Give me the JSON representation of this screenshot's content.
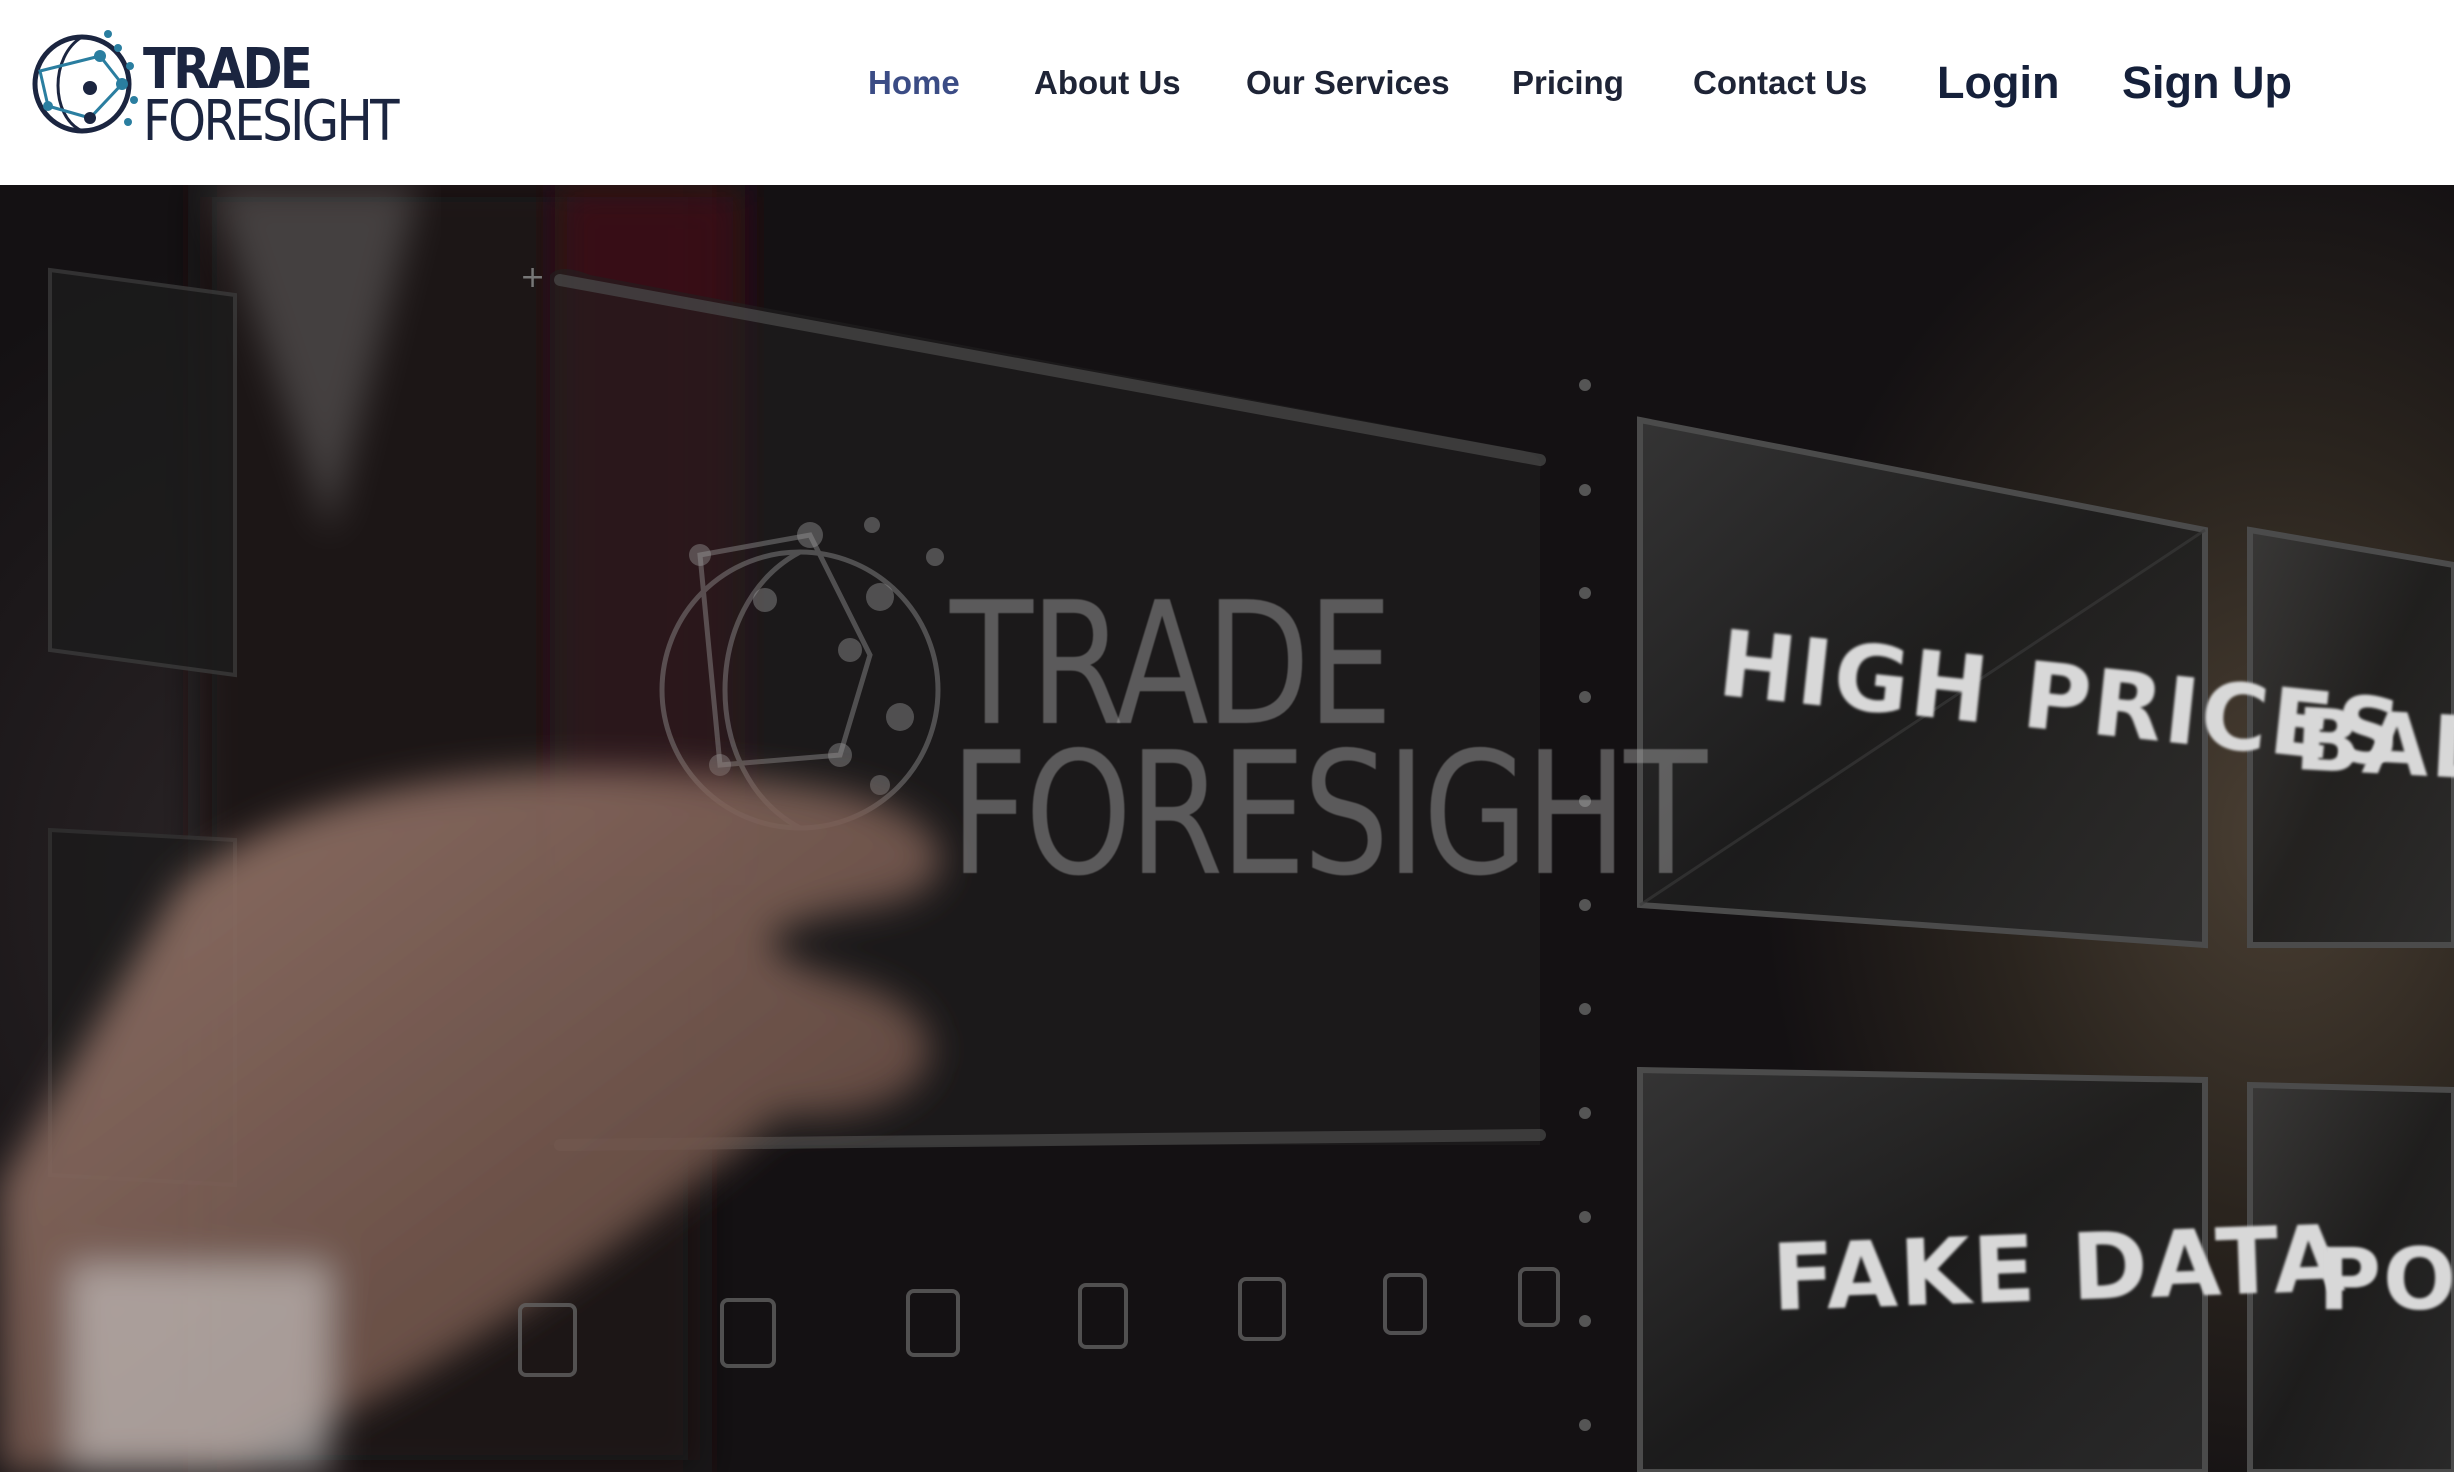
{
  "brand": {
    "line1": "TRADE",
    "line2": "FORESIGHT"
  },
  "nav": {
    "home": "Home",
    "about": "About Us",
    "services": "Our Services",
    "pricing": "Pricing",
    "contact": "Contact Us",
    "login": "Login",
    "signup": "Sign Up"
  },
  "hero": {
    "watermark_line1": "TRADE",
    "watermark_line2": "FORESIGHT",
    "panels": [
      "HIGH PRICES",
      "BAD Q",
      "FAKE DATA",
      "POOR"
    ]
  },
  "colors": {
    "nav_active": "#3b4c85",
    "brand_navy": "#1b2540",
    "logo_accent": "#2a7ea0"
  }
}
